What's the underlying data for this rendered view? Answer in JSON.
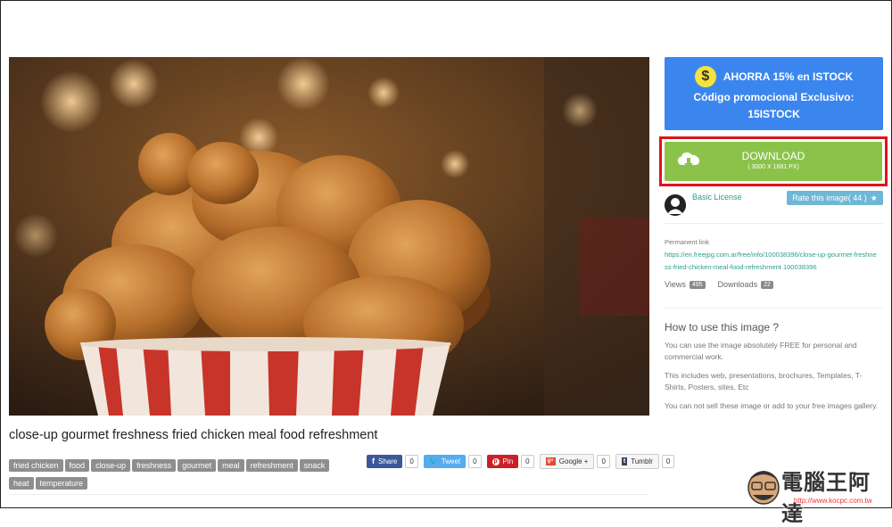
{
  "photo": {
    "alt": "fried chicken bucket"
  },
  "title": "close-up gourmet freshness fried chicken meal food refreshment",
  "tags": [
    "fried chicken",
    "food",
    "close-up",
    "freshness",
    "gourmet",
    "meal",
    "refreshment",
    "snack",
    "heat",
    "temperature"
  ],
  "share": [
    {
      "label": "Share",
      "count": "0",
      "color": "#3b5998"
    },
    {
      "label": "Tweet",
      "count": "0",
      "color": "#55acee"
    },
    {
      "label": "Pin",
      "count": "0",
      "color": "#cb2027"
    },
    {
      "label": "Google +",
      "count": "0",
      "color": "#f5f5f5"
    },
    {
      "label": "Tumblr",
      "count": "0",
      "color": "#f5f5f5"
    }
  ],
  "promo": {
    "coin": "$",
    "line1": "AHORRA 15% en ISTOCK",
    "line2": "Código promocional Exclusivo:",
    "line3": "15ISTOCK",
    "color": "#3b86ee"
  },
  "download": {
    "label": "DOWNLOAD",
    "sub": "( 3000 X 1681 PX)",
    "color": "#8bc34a"
  },
  "license": "Basic License",
  "rate": {
    "label": "Rate this image( 44 )",
    "star": "★"
  },
  "permalink": {
    "label": "Permanent link",
    "url": "https://en.freejpg.com.ar/free/info/100038396/close-up-gourmet-freshness-fried-chicken-meal-food-refreshment 100038396"
  },
  "stats": {
    "views_label": "Views",
    "views": "495",
    "downloads_label": "Downloads",
    "downloads": "22"
  },
  "howto": {
    "title": "How to use this image ?",
    "p1": "You can use the image absolutely FREE for personal and commercial work.",
    "p2": "This includes web, presentations, brochures, Templates, T-Shirts, Posters, sites, Etc",
    "p3": "You can not sell these image or add to your free images gallery."
  },
  "watermark": {
    "text": "電腦王阿達",
    "url": "http://www.kocpc.com.tw"
  }
}
